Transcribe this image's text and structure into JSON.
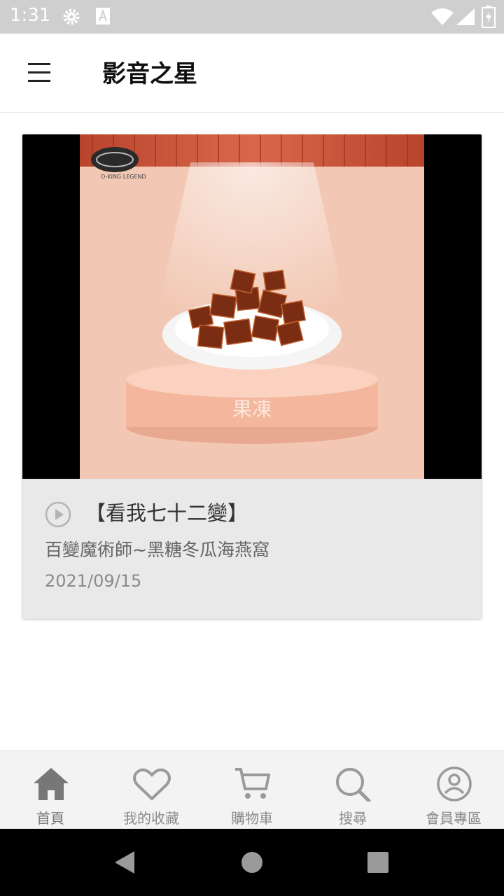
{
  "status_bar": {
    "time": "1:31"
  },
  "app_bar": {
    "title": "影音之星",
    "menu_icon": "hamburger-menu-icon"
  },
  "card": {
    "thumbnail": {
      "overlay_text": "果凍",
      "logo_text": "O-KING LEGEND"
    },
    "title": "【看我七十二變】",
    "subtitle": "百變魔術師~黑糖冬瓜海燕窩",
    "date": "2021/09/15"
  },
  "bottom_nav": {
    "items": [
      {
        "label": "首頁",
        "icon": "home-icon"
      },
      {
        "label": "我的收藏",
        "icon": "heart-icon"
      },
      {
        "label": "購物車",
        "icon": "cart-icon"
      },
      {
        "label": "搜尋",
        "icon": "search-icon"
      },
      {
        "label": "會員專區",
        "icon": "user-icon"
      }
    ]
  },
  "colors": {
    "nav_active": "#777777",
    "nav_inactive": "#9a9a9a",
    "thumbnail_bg": "#f2c8b4"
  }
}
